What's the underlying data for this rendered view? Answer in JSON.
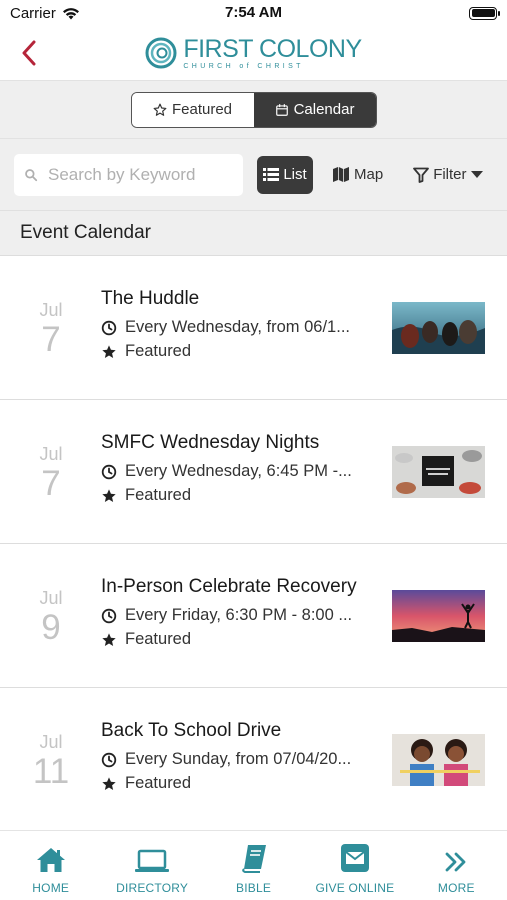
{
  "status": {
    "carrier": "Carrier",
    "time": "7:54 AM"
  },
  "header": {
    "logo_title": "FIRST COLONY",
    "logo_subtitle": "CHURCH of CHRIST"
  },
  "segments": {
    "featured": "Featured",
    "calendar": "Calendar",
    "selected": "Calendar"
  },
  "toolbar": {
    "search_placeholder": "Search by Keyword",
    "list_label": "List",
    "map_label": "Map",
    "filter_label": "Filter"
  },
  "section_title": "Event Calendar",
  "events": [
    {
      "month": "Jul",
      "day": "7",
      "title": "The Huddle",
      "schedule": "Every Wednesday, from 06/1...",
      "tag": "Featured"
    },
    {
      "month": "Jul",
      "day": "7",
      "title": "SMFC Wednesday Nights",
      "schedule": "Every Wednesday, 6:45 PM -...",
      "tag": "Featured"
    },
    {
      "month": "Jul",
      "day": "9",
      "title": "In-Person Celebrate Recovery",
      "schedule": "Every Friday, 6:30 PM - 8:00 ...",
      "tag": "Featured"
    },
    {
      "month": "Jul",
      "day": "11",
      "title": "Back To School Drive",
      "schedule": "Every Sunday, from 07/04/20...",
      "tag": "Featured"
    }
  ],
  "tabs": [
    {
      "label": "HOME",
      "icon": "home-icon"
    },
    {
      "label": "DIRECTORY",
      "icon": "laptop-icon"
    },
    {
      "label": "BIBLE",
      "icon": "book-icon"
    },
    {
      "label": "GIVE ONLINE",
      "icon": "envelope-icon"
    },
    {
      "label": "MORE",
      "icon": "double-chevron-icon"
    }
  ],
  "colors": {
    "accent": "#2f8e9a",
    "back_arrow": "#b5253a",
    "segment_active": "#3a3a3a",
    "muted_date": "#c4c4c4"
  }
}
